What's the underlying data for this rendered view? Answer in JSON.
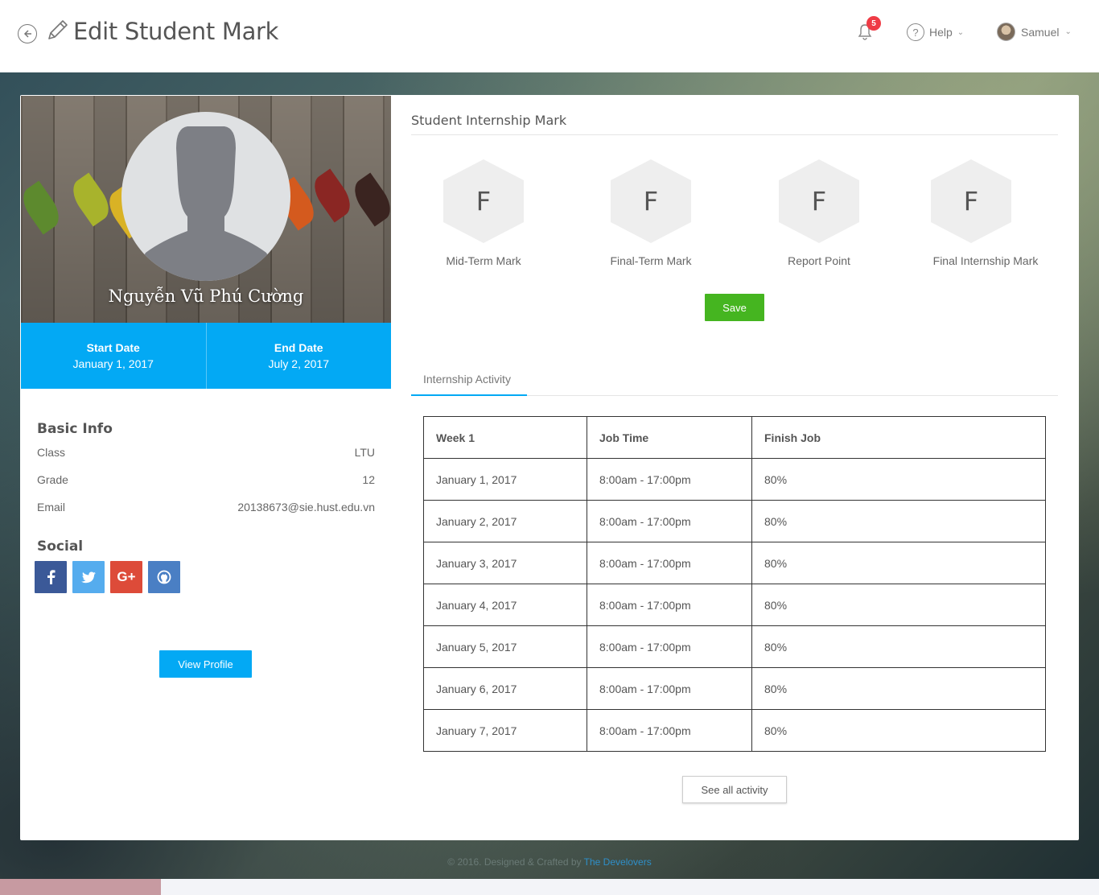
{
  "header": {
    "title": "Edit Student Mark",
    "notification_count": "5",
    "help_label": "Help",
    "user_name": "Samuel"
  },
  "profile": {
    "name": "Nguyễn Vũ Phú Cường",
    "start_date_label": "Start Date",
    "start_date": "January 1, 2017",
    "end_date_label": "End Date",
    "end_date": "July 2, 2017"
  },
  "basic_info": {
    "title": "Basic Info",
    "rows": [
      {
        "label": "Class",
        "value": "LTU"
      },
      {
        "label": "Grade",
        "value": "12"
      },
      {
        "label": "Email",
        "value": "20138673@sie.hust.edu.vn"
      }
    ]
  },
  "social": {
    "title": "Social",
    "buttons": [
      {
        "name": "facebook-icon",
        "glyph": "f",
        "color": "#3b5998"
      },
      {
        "name": "twitter-icon",
        "glyph": "t",
        "color": "#55acee"
      },
      {
        "name": "google-plus-icon",
        "glyph": "G+",
        "color": "#dd4b39"
      },
      {
        "name": "github-icon",
        "glyph": "gh",
        "color": "#4a7fc4"
      }
    ],
    "view_profile_label": "View Profile"
  },
  "marks": {
    "title": "Student Internship Mark",
    "items": [
      {
        "grade": "F",
        "label": "Mid-Term Mark"
      },
      {
        "grade": "F",
        "label": "Final-Term Mark"
      },
      {
        "grade": "F",
        "label": "Report Point"
      },
      {
        "grade": "F",
        "label": "Final Internship Mark"
      }
    ],
    "save_label": "Save"
  },
  "activity": {
    "tab_label": "Internship Activity",
    "headers": [
      "Week 1",
      "Job Time",
      "Finish Job"
    ],
    "rows": [
      [
        "January 1, 2017",
        "8:00am - 17:00pm",
        "80%"
      ],
      [
        "January 2, 2017",
        "8:00am - 17:00pm",
        "80%"
      ],
      [
        "January 3, 2017",
        "8:00am - 17:00pm",
        "80%"
      ],
      [
        "January 4, 2017",
        "8:00am - 17:00pm",
        "80%"
      ],
      [
        "January 5, 2017",
        "8:00am - 17:00pm",
        "80%"
      ],
      [
        "January 6, 2017",
        "8:00am - 17:00pm",
        "80%"
      ],
      [
        "January 7, 2017",
        "8:00am - 17:00pm",
        "80%"
      ]
    ],
    "see_all_label": "See all activity"
  },
  "footer": {
    "text": "© 2016. Designed & Crafted by ",
    "link": "The Develovers"
  },
  "colors": {
    "accent": "#03a9f4",
    "save": "#45b520",
    "badge": "#ef3b45"
  }
}
